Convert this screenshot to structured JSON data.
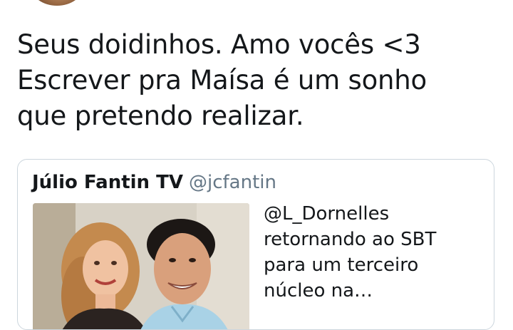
{
  "tweet": {
    "lines": [
      "Seus doidinhos. Amo vocês <3",
      "Escrever pra Maísa é um sonho",
      "que pretendo realizar."
    ]
  },
  "quoted_tweet": {
    "author_name": "Júlio Fantin TV",
    "author_handle": "@jcfantin",
    "text_lines": [
      "@L_Dornelles",
      "retornando ao SBT",
      "para um terceiro",
      "núcleo na…"
    ],
    "media": "photo of two people"
  }
}
